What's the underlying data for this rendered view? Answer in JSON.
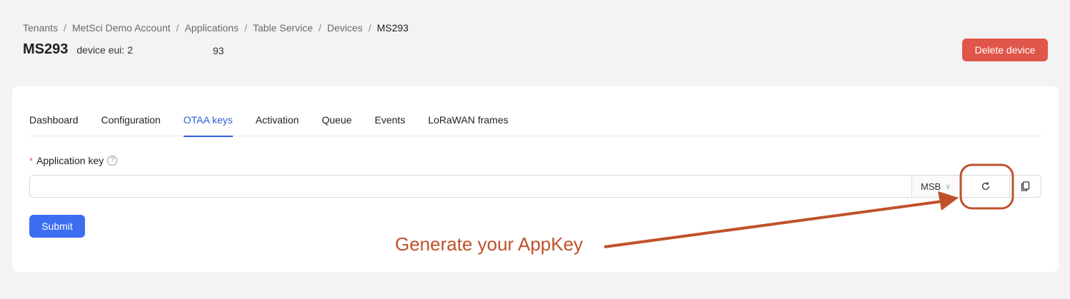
{
  "breadcrumb": [
    {
      "label": "Tenants"
    },
    {
      "label": "MetSci Demo Account"
    },
    {
      "label": "Applications"
    },
    {
      "label": "Table Service"
    },
    {
      "label": "Devices"
    },
    {
      "label": "MS293"
    }
  ],
  "breadcrumb_separator": "/",
  "header": {
    "title": "MS293",
    "eui_label": "device eui:",
    "eui_value_start": "2",
    "eui_value_end": "93",
    "delete_label": "Delete device"
  },
  "tabs": [
    {
      "label": "Dashboard"
    },
    {
      "label": "Configuration"
    },
    {
      "label": "OTAA keys",
      "active": true
    },
    {
      "label": "Activation"
    },
    {
      "label": "Queue"
    },
    {
      "label": "Events"
    },
    {
      "label": "LoRaWAN frames"
    }
  ],
  "form": {
    "required_mark": "*",
    "app_key_label": "Application key",
    "help_icon": "?",
    "app_key_value": "",
    "byte_order": "MSB",
    "generate_icon": "refresh-icon",
    "copy_icon": "copy-icon",
    "submit_label": "Submit"
  },
  "annotation": {
    "text": "Generate your AppKey",
    "color": "#c0522b"
  },
  "colors": {
    "primary": "#3d6ef2",
    "danger": "#e0564a",
    "active_tab": "#2f5fd7"
  }
}
